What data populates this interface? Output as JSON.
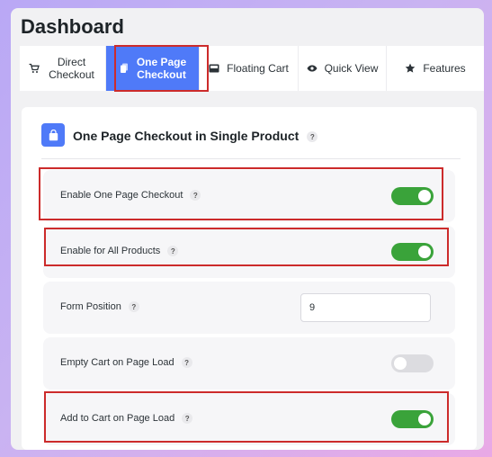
{
  "header": {
    "title": "Dashboard"
  },
  "tabs": [
    {
      "label": "Direct Checkout",
      "icon": "cart-icon",
      "active": false
    },
    {
      "label": "One Page Checkout",
      "icon": "page-icon",
      "active": true
    },
    {
      "label": "Floating Cart",
      "icon": "floating-cart-icon",
      "active": false
    },
    {
      "label": "Quick View",
      "icon": "eye-icon",
      "active": false
    },
    {
      "label": "Features",
      "icon": "star-icon",
      "active": false
    }
  ],
  "section": {
    "title": "One Page Checkout in Single Product",
    "icon": "shopping-bag-icon",
    "help": "?"
  },
  "settings": [
    {
      "label": "Enable One Page Checkout",
      "help": "?",
      "type": "toggle",
      "on": true
    },
    {
      "label": "Enable for All Products",
      "help": "?",
      "type": "toggle",
      "on": true
    },
    {
      "label": "Form Position",
      "help": "?",
      "type": "number",
      "value": "9"
    },
    {
      "label": "Empty Cart on Page Load",
      "help": "?",
      "type": "toggle",
      "on": false
    },
    {
      "label": "Add to Cart on Page Load",
      "help": "?",
      "type": "toggle",
      "on": true
    }
  ],
  "colors": {
    "accent": "#4f7af8",
    "toggle_on": "#3aa33a",
    "toggle_off": "#dcdce0",
    "highlight": "#cc2b2b"
  }
}
